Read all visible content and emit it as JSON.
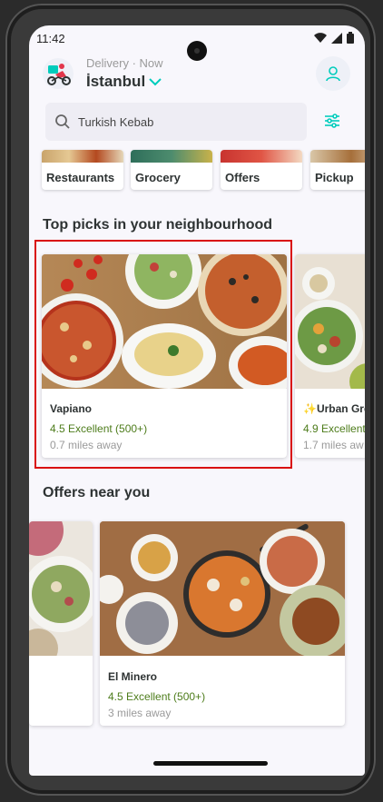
{
  "status_bar": {
    "time": "11:42"
  },
  "header": {
    "delivery_label": "Delivery · Now",
    "city": "İstanbul"
  },
  "search": {
    "text": "Turkish Kebab"
  },
  "categories": [
    {
      "label": "Restaurants"
    },
    {
      "label": "Grocery"
    },
    {
      "label": "Offers"
    },
    {
      "label": "Pickup"
    }
  ],
  "top_picks": {
    "title": "Top picks in your neighbourhood",
    "cards": [
      {
        "name": "Vapiano",
        "rating": "4.5 Excellent (500+)",
        "distance": "0.7 miles away"
      },
      {
        "name": "✨Urban Gre",
        "rating": "4.9 Excellent",
        "distance": "1.7 miles aw"
      }
    ]
  },
  "offers": {
    "title": "Offers near you",
    "cards": [
      {
        "name": "El Minero",
        "rating": "4.5 Excellent (500+)",
        "distance": "3 miles away"
      }
    ]
  },
  "colors": {
    "accent": "#00ccbc",
    "rating_green": "#4d7c1b",
    "highlight_red": "#d90d0d"
  },
  "icons": [
    "rider-logo-icon",
    "chevron-down-icon",
    "account-icon",
    "search-icon",
    "filter-icon",
    "wifi-icon",
    "signal-icon",
    "battery-icon"
  ]
}
